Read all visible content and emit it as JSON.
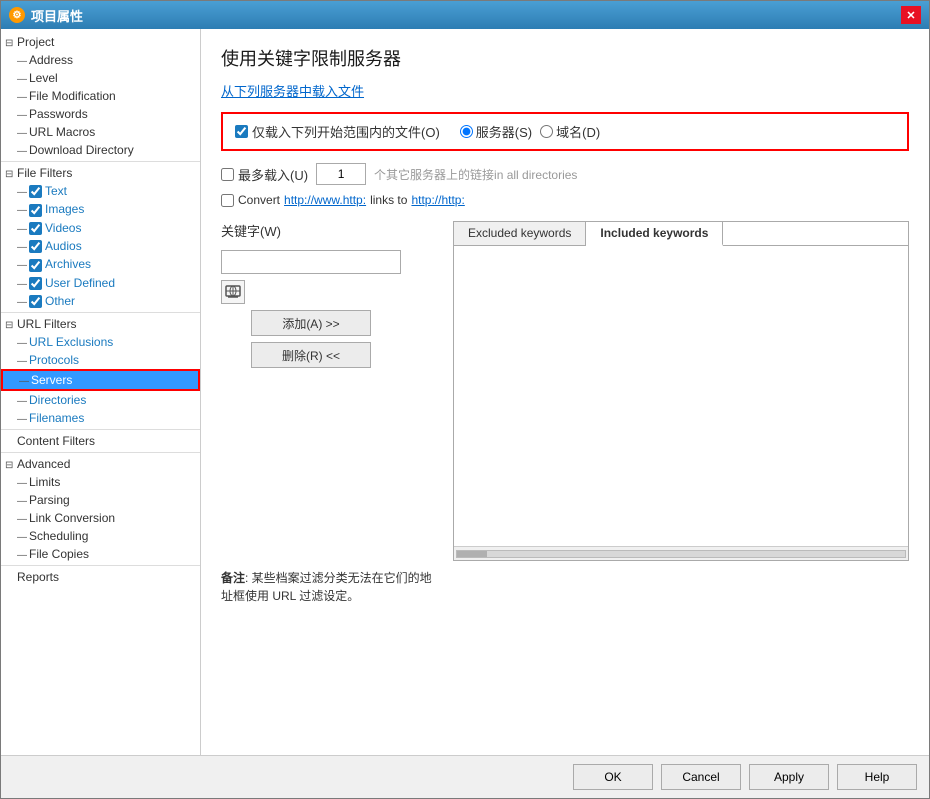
{
  "window": {
    "title": "项目属性",
    "title_icon": "⚙",
    "close_label": "✕"
  },
  "panel": {
    "title": "使用关键字限制服务器",
    "subtitle_link": "从下列服务器中载入文件",
    "checkbox_only": "仅载入下列开始范围内的文件(O)",
    "radio_server": "服务器(S)",
    "radio_domain": "域名(D)",
    "checkbox_max": "最多载入(U)",
    "spin_value": "1",
    "gray_suffix": "个其它服务器上的链接in all directories",
    "convert_label": "Convert",
    "convert_link1": "http://www.http:",
    "convert_mid": "links to",
    "convert_link2": "http://http:",
    "keywords_label": "关键字(W)",
    "add_btn": "添加(A) >>",
    "del_btn": "删除(R) <<",
    "tab_excluded": "Excluded keywords",
    "tab_included": "Included keywords",
    "note_bold": "备注",
    "note_text": ": 某些档案过滤分类无法在它们的地址框使用 URL 过滤设定。"
  },
  "sidebar": {
    "items": [
      {
        "id": "project",
        "label": "Project",
        "level": "root",
        "expand": "⊟",
        "selected": false
      },
      {
        "id": "address",
        "label": "Address",
        "level": "l1",
        "expand": "—",
        "selected": false
      },
      {
        "id": "level",
        "label": "Level",
        "level": "l1",
        "expand": "—",
        "selected": false
      },
      {
        "id": "file-modification",
        "label": "File Modification",
        "level": "l1",
        "expand": "—",
        "selected": false
      },
      {
        "id": "passwords",
        "label": "Passwords",
        "level": "l1",
        "expand": "—",
        "selected": false
      },
      {
        "id": "url-macros",
        "label": "URL Macros",
        "level": "l1",
        "expand": "—",
        "selected": false
      },
      {
        "id": "download-directory",
        "label": "Download Directory",
        "level": "l1",
        "expand": "—",
        "selected": false
      },
      {
        "id": "file-filters",
        "label": "File Filters",
        "level": "root",
        "expand": "⊟",
        "selected": false
      },
      {
        "id": "text",
        "label": "Text",
        "level": "l1",
        "expand": "—",
        "selected": false,
        "checked": true
      },
      {
        "id": "images",
        "label": "Images",
        "level": "l1",
        "expand": "—",
        "selected": false,
        "checked": true
      },
      {
        "id": "videos",
        "label": "Videos",
        "level": "l1",
        "expand": "—",
        "selected": false,
        "checked": true
      },
      {
        "id": "audios",
        "label": "Audios",
        "level": "l1",
        "expand": "—",
        "selected": false,
        "checked": true
      },
      {
        "id": "archives",
        "label": "Archives",
        "level": "l1",
        "expand": "—",
        "selected": false,
        "checked": true
      },
      {
        "id": "user-defined",
        "label": "User Defined",
        "level": "l1",
        "expand": "—",
        "selected": false,
        "checked": true
      },
      {
        "id": "other",
        "label": "Other",
        "level": "l1",
        "expand": "—",
        "selected": false,
        "checked": true
      },
      {
        "id": "url-filters",
        "label": "URL Filters",
        "level": "root",
        "expand": "⊟",
        "selected": false
      },
      {
        "id": "url-exclusions",
        "label": "URL Exclusions",
        "level": "l1",
        "expand": "—",
        "selected": false
      },
      {
        "id": "protocols",
        "label": "Protocols",
        "level": "l1",
        "expand": "—",
        "selected": false
      },
      {
        "id": "servers",
        "label": "Servers",
        "level": "l1",
        "expand": "—",
        "selected": true
      },
      {
        "id": "directories",
        "label": "Directories",
        "level": "l1",
        "expand": "—",
        "selected": false
      },
      {
        "id": "filenames",
        "label": "Filenames",
        "level": "l1",
        "expand": "—",
        "selected": false
      },
      {
        "id": "content-filters",
        "label": "Content Filters",
        "level": "root",
        "expand": "",
        "selected": false
      },
      {
        "id": "advanced",
        "label": "Advanced",
        "level": "root",
        "expand": "⊟",
        "selected": false
      },
      {
        "id": "limits",
        "label": "Limits",
        "level": "l1",
        "expand": "—",
        "selected": false
      },
      {
        "id": "parsing",
        "label": "Parsing",
        "level": "l1",
        "expand": "—",
        "selected": false
      },
      {
        "id": "link-conversion",
        "label": "Link Conversion",
        "level": "l1",
        "expand": "—",
        "selected": false
      },
      {
        "id": "scheduling",
        "label": "Scheduling",
        "level": "l1",
        "expand": "—",
        "selected": false
      },
      {
        "id": "file-copies",
        "label": "File Copies",
        "level": "l1",
        "expand": "—",
        "selected": false
      },
      {
        "id": "reports",
        "label": "Reports",
        "level": "root",
        "expand": "",
        "selected": false
      }
    ]
  },
  "buttons": {
    "ok": "OK",
    "cancel": "Cancel",
    "apply": "Apply",
    "help": "Help"
  }
}
